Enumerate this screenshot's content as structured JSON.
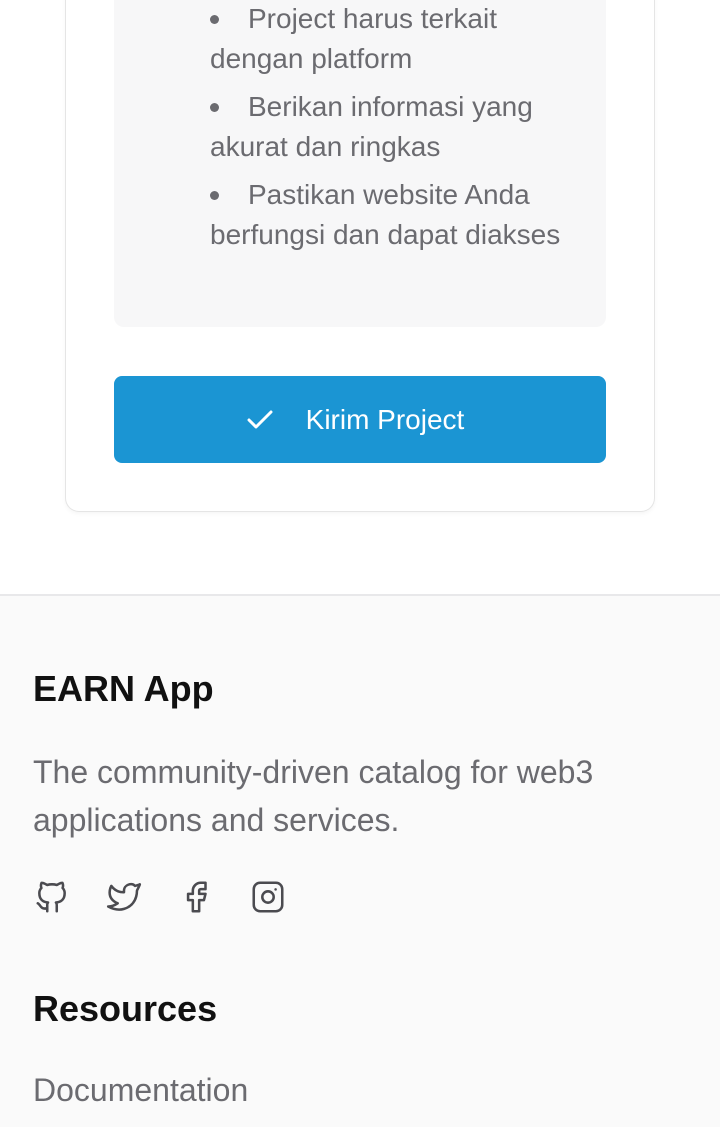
{
  "guidelines": {
    "items": [
      "Project harus terkait dengan platform",
      "Berikan informasi yang akurat dan ringkas",
      "Pastikan website Anda berfungsi dan dapat diakses"
    ]
  },
  "submit": {
    "label": "Kirim Project",
    "icon": "check-icon",
    "color": "#1b95d3"
  },
  "footer": {
    "brand_title": "EARN App",
    "brand_description": "The community-driven catalog for web3 applications and services.",
    "socials": [
      "github-icon",
      "twitter-icon",
      "facebook-icon",
      "instagram-icon"
    ],
    "resources_title": "Resources",
    "resources_links": [
      "Documentation"
    ]
  }
}
